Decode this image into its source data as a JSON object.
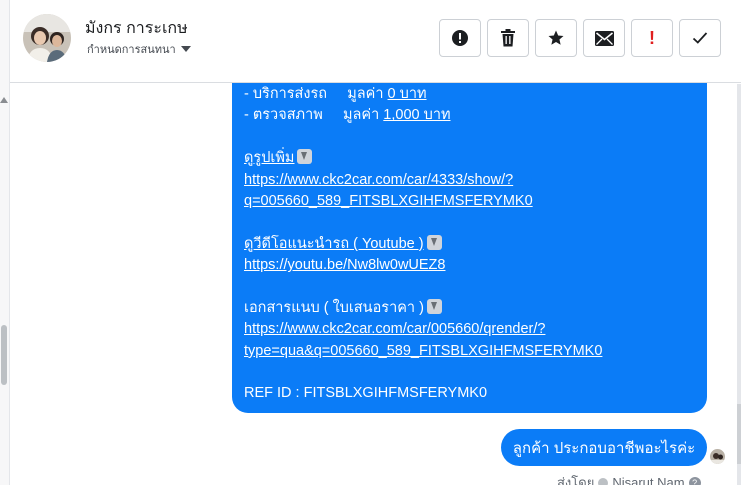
{
  "header": {
    "contact_name": "มังกร การะเกษ",
    "subtitle": "กำหนดการสนทนา",
    "toolbar": {
      "spam_icon": "alert-circle-icon",
      "delete_icon": "trash-icon",
      "star_icon": "star-icon",
      "mail_icon": "envelope-icon",
      "important_label": "!",
      "done_icon": "checkmark-icon"
    }
  },
  "message": {
    "lines": {
      "service_label": "- บริการส่งรถ",
      "service_value_prefix": "มูลค่า ",
      "service_value": "0 บาท",
      "inspect_label": "- ตรวจสภาพ",
      "inspect_value_prefix": "มูลค่า ",
      "inspect_value": "1,000 บาท",
      "more_photos": "ดูรูปเพิ่ม",
      "photos_link_1": "https://www.ckc2car.com/car/4333/show/?",
      "photos_link_2": "q=005660_589_FITSBLXGIHFMSFERYMK0",
      "video_label": "ดูวีดีโอแนะนำรถ ( Youtube )",
      "video_link": "https://youtu.be/Nw8lw0wUEZ8",
      "docs_label": "เอกสารแนบ ( ใบเสนอราคา )",
      "docs_link_1": "https://www.ckc2car.com/car/005660/qrender/?",
      "docs_link_2": "type=qua&q=005660_589_FITSBLXGIHFMSFERYMK0",
      "ref_id": "REF ID : FITSBLXGIHFMSFERYMK0"
    }
  },
  "reply": {
    "text": "ลูกค้า ประกอบอาชีพอะไรค่ะ",
    "sent_by_prefix": "ส่งโดย",
    "sent_by_name": "Nisarut Nam",
    "help_glyph": "?"
  },
  "colors": {
    "bubble": "#0b7cf7",
    "border": "#ccd0d5"
  }
}
